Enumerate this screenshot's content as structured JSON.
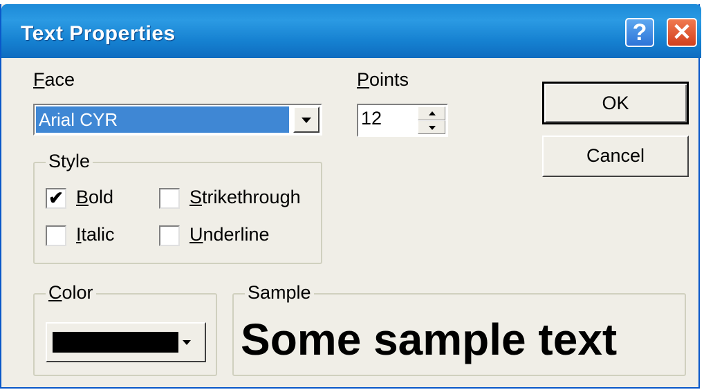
{
  "window": {
    "title": "Text Properties",
    "help_glyph": "?",
    "close_glyph": "✕",
    "accent_color": "#1c8ad8"
  },
  "face": {
    "label_first": "F",
    "label_rest": "ace",
    "selected": "Arial CYR"
  },
  "points": {
    "label_first": "P",
    "label_rest": "oints",
    "value": "12"
  },
  "buttons": {
    "ok": "OK",
    "cancel": "Cancel"
  },
  "style": {
    "legend": "Style",
    "bold": {
      "first": "B",
      "rest": "old",
      "checked": true,
      "mark": "✔"
    },
    "italic": {
      "first": "I",
      "rest": "talic",
      "checked": false
    },
    "strikethrough": {
      "first": "S",
      "rest": "trikethrough",
      "checked": false
    },
    "underline": {
      "first": "U",
      "rest": "nderline",
      "checked": false
    }
  },
  "color": {
    "legend_first": "C",
    "legend_rest": "olor",
    "value": "#000000"
  },
  "sample": {
    "legend": "Sample",
    "text": "Some sample text"
  }
}
